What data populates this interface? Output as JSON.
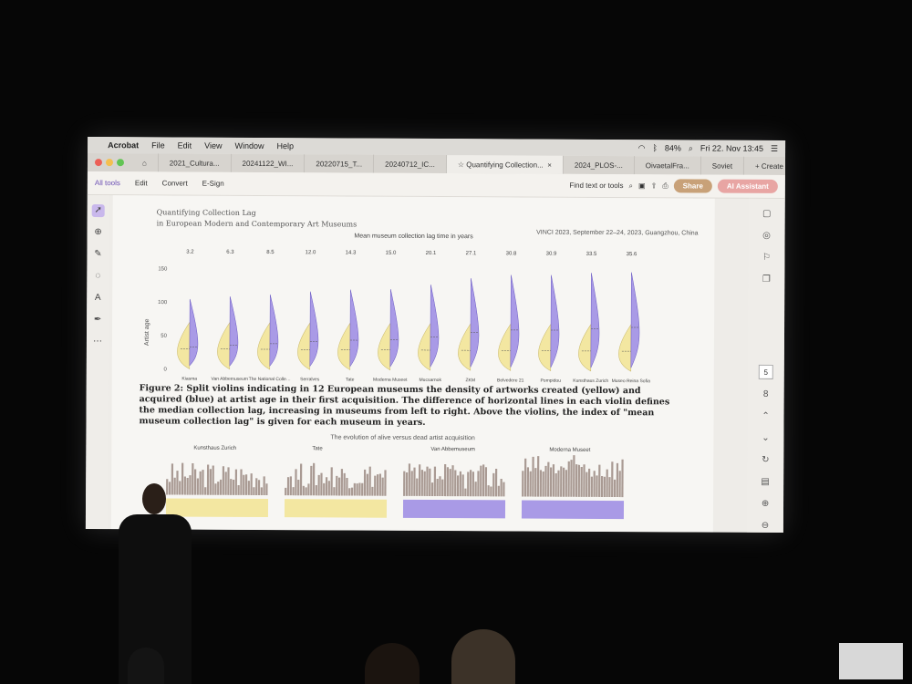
{
  "menubar": {
    "app_name": "Acrobat",
    "items": [
      "File",
      "Edit",
      "View",
      "Window",
      "Help"
    ],
    "battery": "84%",
    "datetime": "Fri 22. Nov  13:45"
  },
  "tabs": [
    {
      "label": "2021_Cultura..."
    },
    {
      "label": "20241122_WI..."
    },
    {
      "label": "20220715_T..."
    },
    {
      "label": "20240712_IC..."
    },
    {
      "label": "Quantifying Collection..."
    },
    {
      "label": "2024_PLOS-..."
    },
    {
      "label": "OivaetalFra..."
    },
    {
      "label": "Soviet"
    }
  ],
  "create_label": "+ Create",
  "toolbar": {
    "items": [
      "All tools",
      "Edit",
      "Convert",
      "E-Sign"
    ],
    "find_placeholder": "Find text or tools",
    "share_label": "Share",
    "ai_label": "AI Assistant"
  },
  "page_indicator": {
    "current": "5",
    "total": "8"
  },
  "document": {
    "heading_line1": "Quantifying Collection Lag",
    "heading_line2": "in European Modern and Contemporary Art Museums",
    "conference": "VINCI 2023, September 22–24, 2023, Guangzhou, China",
    "chart_title": "Mean museum collection lag time in years",
    "caption": "Figure 2: Split violins indicating in 12 European museums the density of artworks created (yellow) and acquired (blue) at artist age in their first acquisition. The difference of horizontal lines in each violin defines the median collection lag, increasing in museums from left to right. Above the violins, the index of \"mean museum collection lag\" is given for each museum in years.",
    "subtitle2": "The evolution of alive versus dead artist acquisition",
    "small_titles": [
      "Kunsthaus Zurich",
      "Tate",
      "Van Abbemuseum",
      "Moderna Museet"
    ]
  },
  "chart_data": {
    "type": "violin",
    "title": "Mean museum collection lag time in years",
    "ylabel": "Artist age",
    "ylim": [
      0,
      150
    ],
    "yticks": [
      0,
      50,
      100,
      150
    ],
    "categories": [
      "Kiasma",
      "Van Abbemuseum",
      "The National Collection of Norway",
      "Serralves",
      "Tate",
      "Moderna Museet",
      "Mucsarnok",
      "ZKM",
      "Belvedere 21",
      "Pompidou",
      "Kunsthaus Zurich",
      "Museo Reina Sofia"
    ],
    "values": [
      3.2,
      6.3,
      8.5,
      12.0,
      14.3,
      15.0,
      20.1,
      27.1,
      30.8,
      30.9,
      33.5,
      35.6
    ],
    "series": [
      {
        "name": "created",
        "color": "#f3e7a1"
      },
      {
        "name": "acquired",
        "color": "#a99ae6"
      }
    ]
  },
  "colors": {
    "yellow": "#f3e7a1",
    "purple": "#a99ae6",
    "accent": "#6b4fb3",
    "bars": "#a99a93"
  }
}
